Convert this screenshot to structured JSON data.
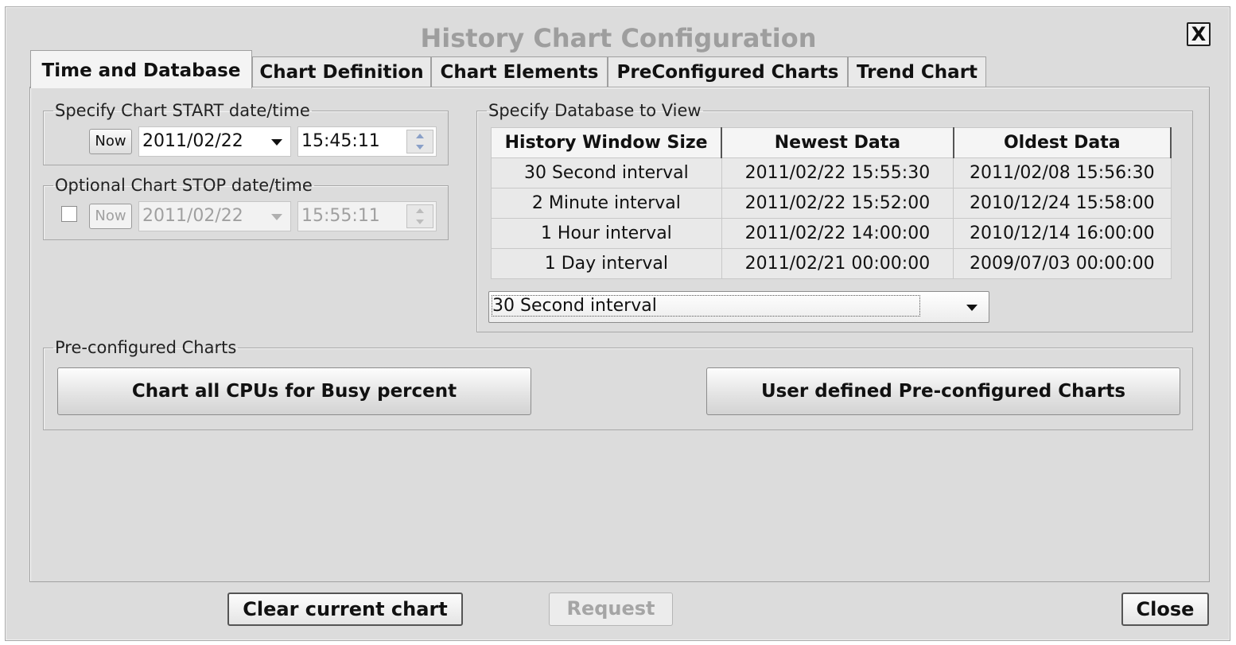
{
  "window": {
    "title": "History Chart Configuration",
    "close_x_label": "X"
  },
  "tabs": [
    {
      "label": "Time and Database",
      "active": true
    },
    {
      "label": "Chart Definition",
      "active": false
    },
    {
      "label": "Chart Elements",
      "active": false
    },
    {
      "label": "PreConfigured Charts",
      "active": false
    },
    {
      "label": "Trend Chart",
      "active": false
    }
  ],
  "start_group": {
    "legend": "Specify Chart START date/time",
    "now_label": "Now",
    "date_value": "2011/02/22",
    "time_value": "15:45:11"
  },
  "stop_group": {
    "legend": "Optional Chart STOP date/time",
    "enabled": false,
    "checked": false,
    "now_label": "Now",
    "date_value": "2011/02/22",
    "time_value": "15:55:11"
  },
  "database_group": {
    "legend": "Specify Database to View",
    "columns": [
      "History Window Size",
      "Newest Data",
      "Oldest Data"
    ],
    "rows": [
      [
        "30 Second interval",
        "2011/02/22 15:55:30",
        "2011/02/08 15:56:30"
      ],
      [
        "2 Minute interval",
        "2011/02/22 15:52:00",
        "2010/12/24 15:58:00"
      ],
      [
        "1 Hour interval",
        "2011/02/22 14:00:00",
        "2010/12/14 16:00:00"
      ],
      [
        "1 Day interval",
        "2011/02/21 00:00:00",
        "2009/07/03 00:00:00"
      ]
    ],
    "selected_interval": "30 Second interval"
  },
  "preconfigured_group": {
    "legend": "Pre-configured Charts",
    "cpu_button": "Chart all CPUs for Busy percent",
    "user_button": "User defined Pre-configured Charts"
  },
  "footer": {
    "clear_label": "Clear current chart",
    "request_label": "Request",
    "close_label": "Close"
  }
}
